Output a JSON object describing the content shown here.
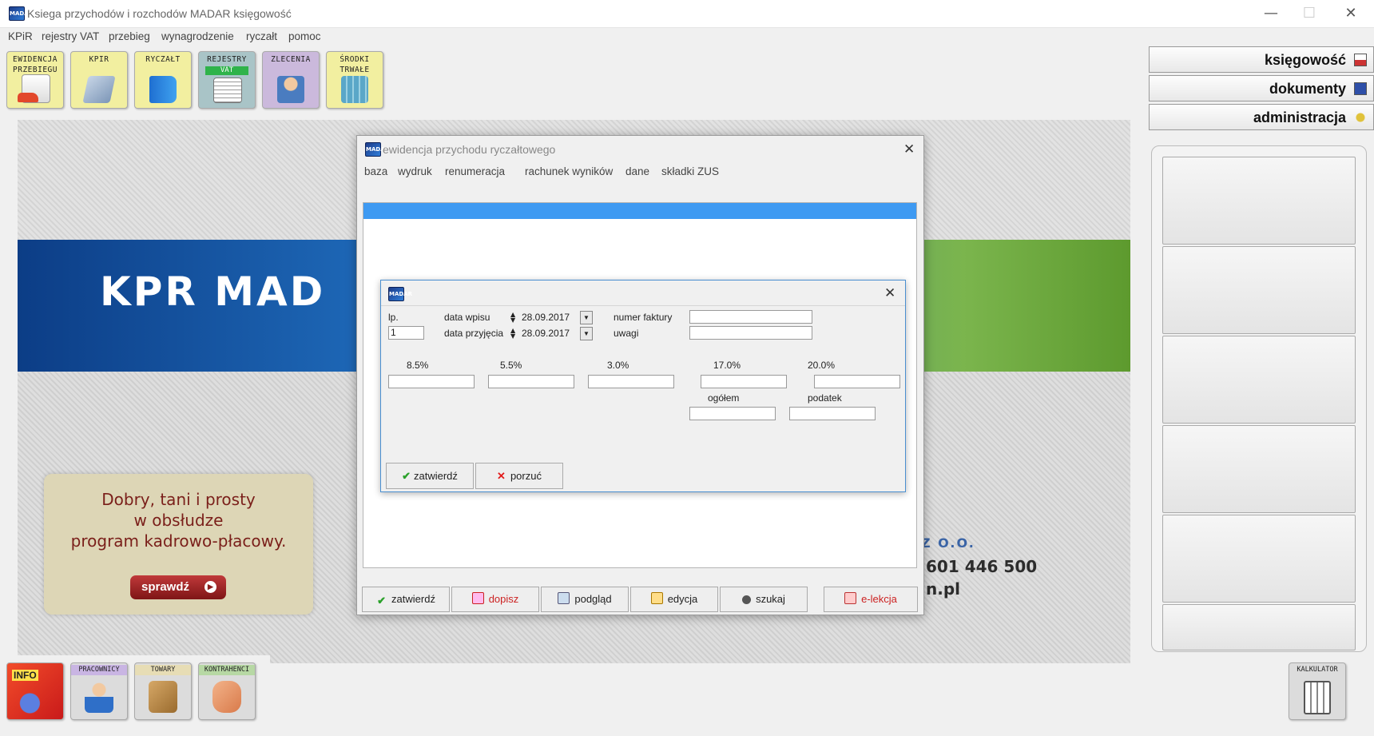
{
  "window": {
    "title": "Ksiega przychodów i rozchodów MADAR  księgowość",
    "app_icon": "MADAR",
    "minimize": "—",
    "maximize": "☐",
    "close": "✕"
  },
  "menu": [
    "KPiR",
    "rejestry VAT",
    "przebieg",
    "wynagrodzenie",
    "ryczałt",
    "pomoc"
  ],
  "toolbar": [
    {
      "label": "EWIDENCJA\nPRZEBIEGU",
      "icon": "car-document-icon"
    },
    {
      "label": "KPIR",
      "icon": "book-icon"
    },
    {
      "label": "RYCZAŁT",
      "icon": "blue-book-icon"
    },
    {
      "label": "REJESTRY",
      "sub": "VAT",
      "icon": "register-icon"
    },
    {
      "label": "ZLECENIA",
      "icon": "person-contract-icon"
    },
    {
      "label": "ŚRODKI\nTRWAŁE",
      "icon": "building-icon"
    }
  ],
  "banner": {
    "title": "KPR MAD",
    "promo_lines": [
      "Dobry, tani i prosty",
      "w obsłudze",
      "program kadrowo-płacowy."
    ],
    "promo_button": "sprawdź",
    "company_suffix": "Z O.O.",
    "phone": "601 446 500",
    "domain": "n.pl"
  },
  "right_panel": {
    "buttons": [
      {
        "label": "księgowość",
        "icon": "ledger-icon"
      },
      {
        "label": "dokumenty",
        "icon": "documents-icon"
      },
      {
        "label": "administracja",
        "icon": "keys-icon"
      }
    ]
  },
  "dialog1": {
    "title": "ewidencja przychodu ryczałtowego",
    "menu": [
      "baza",
      "wydruk",
      "renumeracja",
      "rachunek wyników",
      "dane",
      "składki ZUS"
    ],
    "buttons": [
      "zatwierdź",
      "dopisz",
      "podgląd",
      "edycja",
      "szukaj",
      "e-lekcja"
    ]
  },
  "dialog2": {
    "labels": {
      "lp": "lp.",
      "data_wpisu": "data wpisu",
      "data_przyjecia": "data przyjęcia",
      "numer_faktury": "numer faktury",
      "uwagi": "uwagi",
      "ogolem": "ogółem",
      "podatek": "podatek"
    },
    "values": {
      "lp": "1",
      "data_wpisu": "28.09.2017",
      "data_przyjecia": "28.09.2017",
      "numer_faktury": "",
      "uwagi": ""
    },
    "rates": [
      "8.5%",
      "5.5%",
      "3.0%",
      "17.0%",
      "20.0%"
    ],
    "buttons": {
      "confirm": "zatwierdź",
      "cancel": "porzuć"
    }
  },
  "bottom_tiles": [
    {
      "label": "INFO",
      "icon": "info-chart-icon"
    },
    {
      "label": "PRACOWNICY",
      "icon": "employee-icon"
    },
    {
      "label": "TOWARY",
      "icon": "box-icon"
    },
    {
      "label": "KONTRAHENCI",
      "icon": "handshake-icon"
    }
  ],
  "calculator": {
    "label": "KALKULATOR",
    "icon": "calculator-icon"
  }
}
